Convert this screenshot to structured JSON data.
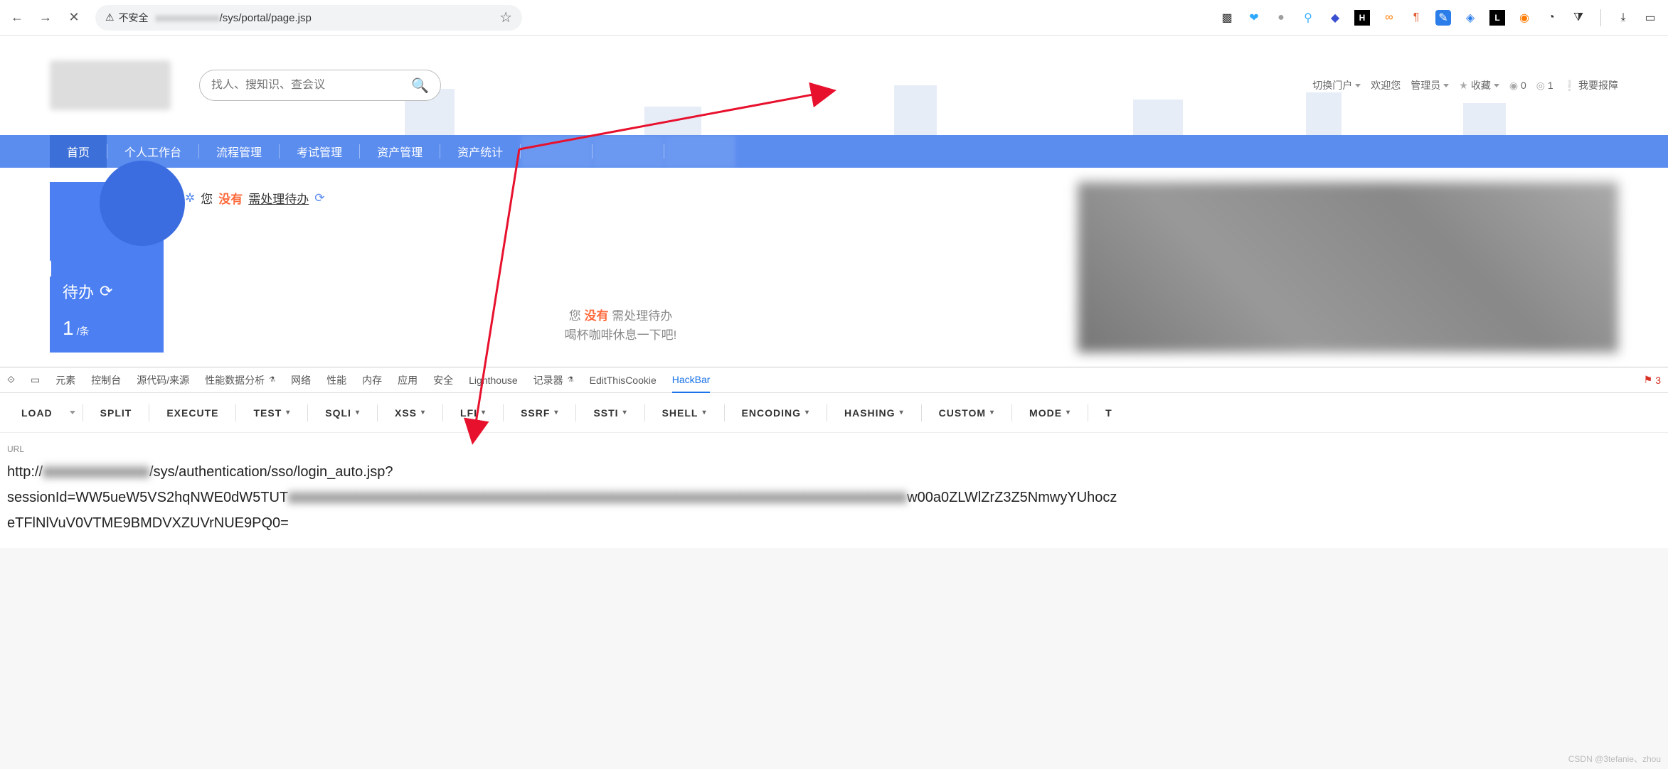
{
  "browser": {
    "insecure_label": "不安全",
    "url_path": "/sys/portal/page.jsp"
  },
  "portal": {
    "search_placeholder": "找人、搜知识、查会议",
    "header": {
      "switch_portal": "切换门户",
      "welcome": "欢迎您",
      "role": "管理员",
      "favorite": "收藏",
      "count_a": "0",
      "count_b": "1",
      "report": "我要报障"
    },
    "nav": [
      "首页",
      "个人工作台",
      "流程管理",
      "考试管理",
      "资产管理",
      "资产统计"
    ],
    "side": {
      "title": "待办",
      "count": "1",
      "unit": "/条"
    },
    "msg": {
      "you": "您",
      "no": "没有",
      "link": "需处理待办"
    },
    "center": {
      "line1_you": "您",
      "line1_no": "没有",
      "line1_rest": "需处理待办",
      "line2": "喝杯咖啡休息一下吧!"
    }
  },
  "devtools": {
    "tabs": [
      "元素",
      "控制台",
      "源代码/来源",
      "性能数据分析",
      "网络",
      "性能",
      "内存",
      "应用",
      "安全",
      "Lighthouse",
      "记录器",
      "EditThisCookie",
      "HackBar"
    ],
    "active_tab": "HackBar",
    "error_count": "3",
    "hackbar_buttons": [
      "LOAD",
      "SPLIT",
      "EXECUTE",
      "TEST",
      "SQLI",
      "XSS",
      "LFI",
      "SSRF",
      "SSTI",
      "SHELL",
      "ENCODING",
      "HASHING",
      "CUSTOM",
      "MODE",
      "T"
    ],
    "url_label": "URL",
    "url": {
      "line1_pre": "http://",
      "line1_post": "/sys/authentication/sso/login_auto.jsp?",
      "line2_pre": "sessionId=WW5ueW5VS2hqNWE0dW5TUT",
      "line2_post": "w00a0ZLWlZrZ3Z5NmwyYUhocz",
      "line3": "eTFlNlVuV0VTME9BMDVXZUVrNUE9PQ0="
    }
  },
  "watermark": "CSDN @3tefanie、zhou"
}
